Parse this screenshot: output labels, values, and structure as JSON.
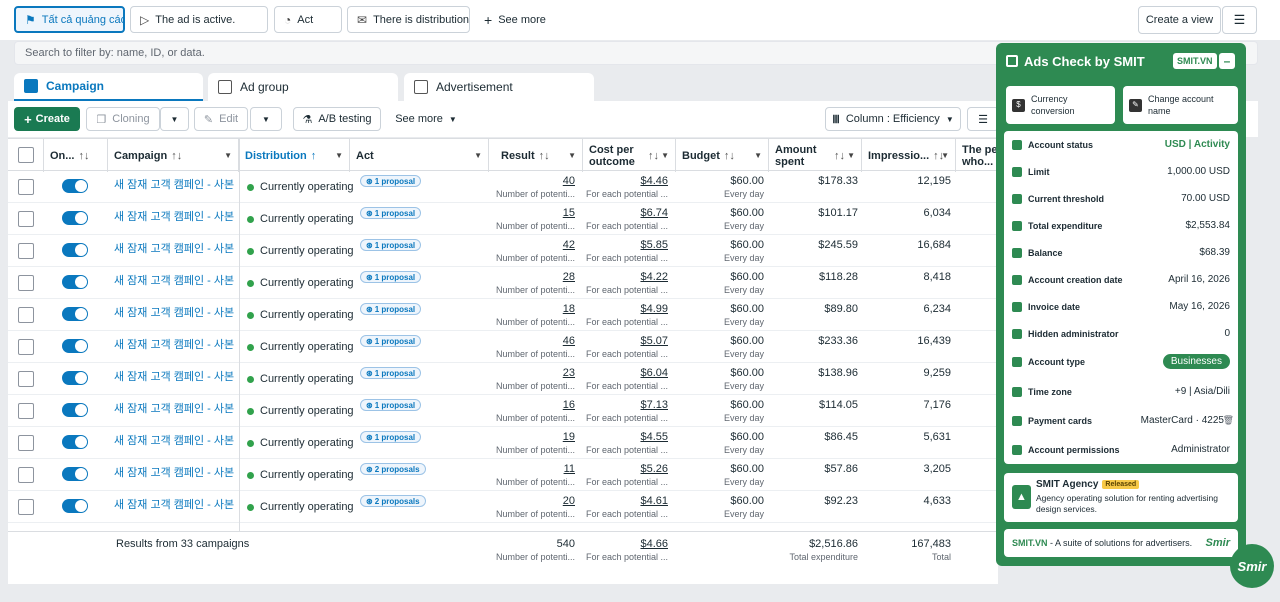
{
  "filters": {
    "all_ads": "Tất cả quảng cáo",
    "ad_active": "The ad is active.",
    "act": "Act",
    "distribution": "There is distribution",
    "see_more": "See more",
    "create_view": "Create a view"
  },
  "search": {
    "placeholder": "Search to filter by: name, ID, or data."
  },
  "tabs": [
    {
      "label": "Campaign"
    },
    {
      "label": "Ad group"
    },
    {
      "label": "Advertisement"
    }
  ],
  "toolbar": {
    "create": "Create",
    "cloning": "Cloning",
    "edit": "Edit",
    "ab_testing": "A/B testing",
    "see_more": "See more",
    "columns": "Column : Efficiency"
  },
  "columns": {
    "on_off": "On...",
    "campaign": "Campaign",
    "distribution": "Distribution",
    "act": "Act",
    "result": "Result",
    "cost_per_outcome_1": "Cost per",
    "cost_per_outcome_2": "outcome",
    "budget": "Budget",
    "amount_spent_1": "Amount",
    "amount_spent_2": "spent",
    "impressions": "Impressio...",
    "reach_1": "The per",
    "reach_2": "who..."
  },
  "row_labels": {
    "status": "Currently operating",
    "result_sub": "Number of potenti...",
    "cost_sub": "For each potential ...",
    "budget_sub": "Every day"
  },
  "rows": [
    {
      "name": "새 잠재 고객 캠페인 - 사본",
      "proposal": "1 proposal",
      "result": "40",
      "cost": "$4.46",
      "budget": "$60.00",
      "spent": "$178.33",
      "impr": "12,195"
    },
    {
      "name": "새 잠재 고객 캠페인 - 사본",
      "proposal": "1 proposal",
      "result": "15",
      "cost": "$6.74",
      "budget": "$60.00",
      "spent": "$101.17",
      "impr": "6,034"
    },
    {
      "name": "새 잠재 고객 캠페인 - 사본",
      "proposal": "1 proposal",
      "result": "42",
      "cost": "$5.85",
      "budget": "$60.00",
      "spent": "$245.59",
      "impr": "16,684"
    },
    {
      "name": "새 잠재 고객 캠페인 - 사본",
      "proposal": "1 proposal",
      "result": "28",
      "cost": "$4.22",
      "budget": "$60.00",
      "spent": "$118.28",
      "impr": "8,418"
    },
    {
      "name": "새 잠재 고객 캠페인 - 사본",
      "proposal": "1 proposal",
      "result": "18",
      "cost": "$4.99",
      "budget": "$60.00",
      "spent": "$89.80",
      "impr": "6,234"
    },
    {
      "name": "새 잠재 고객 캠페인 - 사본",
      "proposal": "1 proposal",
      "result": "46",
      "cost": "$5.07",
      "budget": "$60.00",
      "spent": "$233.36",
      "impr": "16,439"
    },
    {
      "name": "새 잠재 고객 캠페인 - 사본",
      "proposal": "1 proposal",
      "result": "23",
      "cost": "$6.04",
      "budget": "$60.00",
      "spent": "$138.96",
      "impr": "9,259"
    },
    {
      "name": "새 잠재 고객 캠페인 - 사본",
      "proposal": "1 proposal",
      "result": "16",
      "cost": "$7.13",
      "budget": "$60.00",
      "spent": "$114.05",
      "impr": "7,176"
    },
    {
      "name": "새 잠재 고객 캠페인 - 사본",
      "proposal": "1 proposal",
      "result": "19",
      "cost": "$4.55",
      "budget": "$60.00",
      "spent": "$86.45",
      "impr": "5,631"
    },
    {
      "name": "새 잠재 고객 캠페인 - 사본",
      "proposal": "2 proposals",
      "result": "11",
      "cost": "$5.26",
      "budget": "$60.00",
      "spent": "$57.86",
      "impr": "3,205"
    },
    {
      "name": "새 잠재 고객 캠페인 - 사본",
      "proposal": "2 proposals",
      "result": "20",
      "cost": "$4.61",
      "budget": "$60.00",
      "spent": "$92.23",
      "impr": "4,633"
    }
  ],
  "footer": {
    "label": "Results from 33 campaigns",
    "result": "540",
    "result_sub": "Number of potenti...",
    "cost": "$4.66",
    "cost_sub": "For each potential ...",
    "spent": "$2,516.86",
    "spent_sub": "Total expenditure",
    "impr": "167,483",
    "impr_sub": "Total"
  },
  "smit": {
    "title": "Ads Check by SMIT",
    "badge": "SMIT.VN",
    "currency_btn_1": "Currency",
    "currency_btn_2": "conversion",
    "change_btn_1": "Change account",
    "change_btn_2": "name",
    "items": [
      {
        "label": "Account status",
        "value": "USD | Activity"
      },
      {
        "label": "Limit",
        "value": "1,000.00 USD"
      },
      {
        "label": "Current threshold",
        "value": "70.00 USD"
      },
      {
        "label": "Total expenditure",
        "value": "$2,553.84"
      },
      {
        "label": "Balance",
        "value": "$68.39"
      },
      {
        "label": "Account creation date",
        "value": "April 16, 2026"
      },
      {
        "label": "Invoice date",
        "value": "May 16, 2026"
      },
      {
        "label": "Hidden administrator",
        "value": "0"
      },
      {
        "label": "Account type",
        "value": "Businesses"
      },
      {
        "label": "Time zone",
        "value": "+9 | Asia/Dili"
      },
      {
        "label": "Payment cards",
        "value": "MasterCard · 4225"
      },
      {
        "label": "Account permissions",
        "value": "Administrator"
      }
    ],
    "agency_title": "SMIT Agency",
    "agency_badge": "Released",
    "agency_desc_1": "Agency operating solution for renting advertising",
    "agency_desc_2": "design services.",
    "suite_brand": "SMIT.VN",
    "suite_text": " - A suite of solutions for advertisers.",
    "suite_logo": "Smir",
    "bubble": "Smir"
  },
  "colors": {
    "accent": "#0a78be",
    "smit_green": "#2e8a52",
    "create_green": "#1a7a52",
    "status_green": "#31a24c"
  }
}
